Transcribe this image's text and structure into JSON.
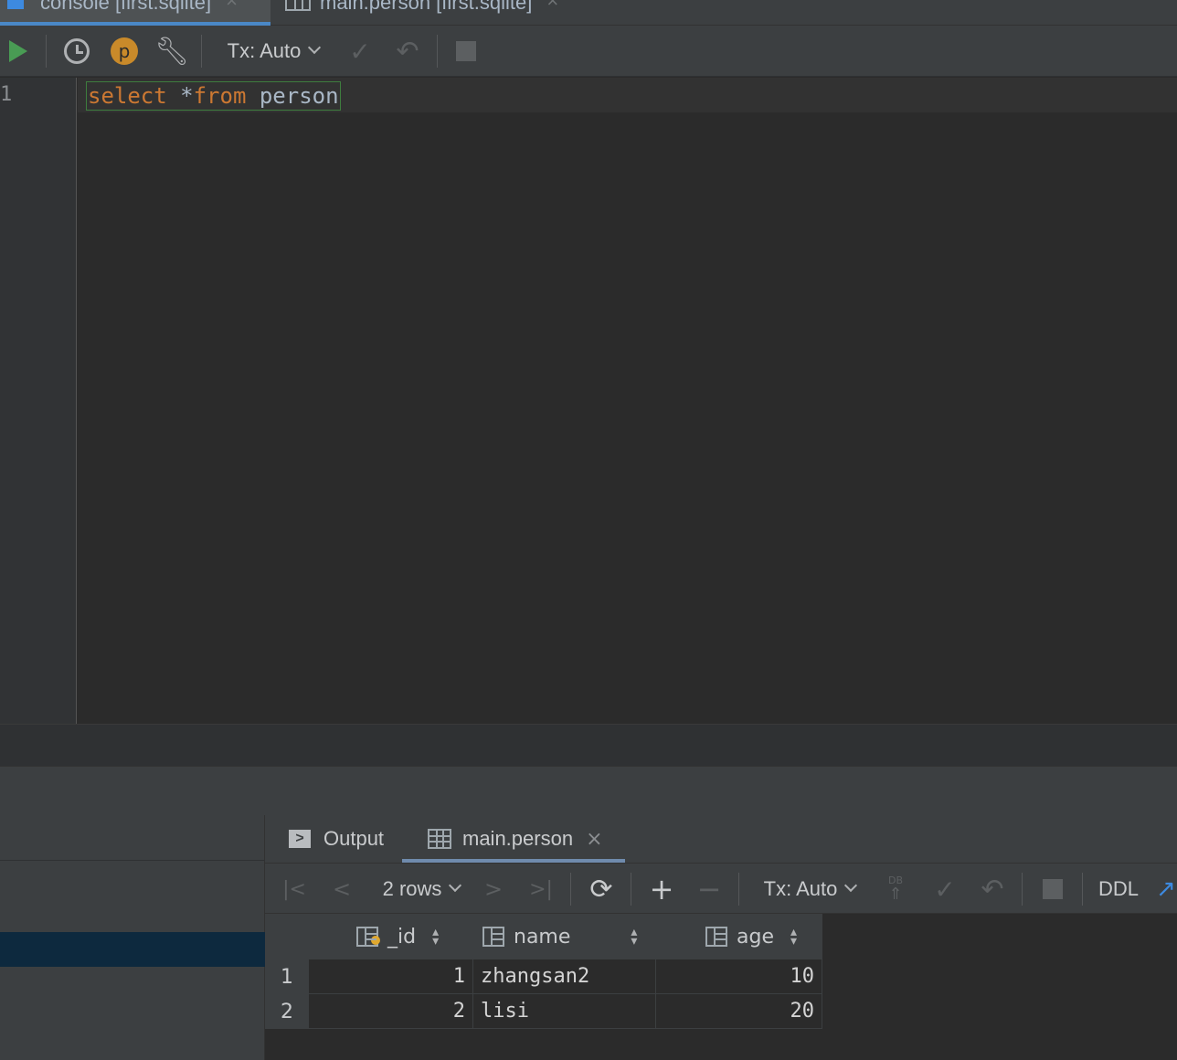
{
  "editor_tabs": [
    {
      "label": "console [first.sqlite]",
      "close": "×",
      "icon": "console-icon",
      "active": true
    },
    {
      "label": "main.person [first.sqlite]",
      "close": "×",
      "icon": "table-icon",
      "active": false
    }
  ],
  "toolbar": {
    "run_icon": "play-icon",
    "history_icon": "clock-icon",
    "profile_badge": "p",
    "settings_icon": "wrench-icon",
    "tx_mode": "Tx: Auto",
    "commit_icon": "check-icon",
    "rollback_icon": "undo-icon",
    "stop_icon": "stop-icon"
  },
  "editor": {
    "line_number": "1",
    "code": {
      "kw1": "select ",
      "op": "*",
      "kw2": "from",
      "space": " ",
      "table": "person"
    }
  },
  "results": {
    "tabs": [
      {
        "label": "Output",
        "icon": "output-icon"
      },
      {
        "label": "main.person",
        "icon": "table-icon",
        "close": "×"
      }
    ],
    "toolbar": {
      "first_icon": "|<",
      "prev_icon": "<",
      "rows_label": "2 rows",
      "next_icon": ">",
      "last_icon": ">|",
      "refresh_icon": "⟳",
      "add_icon": "+",
      "remove_icon": "−",
      "tx_mode": "Tx: Auto",
      "db_label": "DB",
      "ddl_label": "DDL"
    },
    "columns": [
      {
        "name": "_id",
        "icon": "primary-key-column-icon"
      },
      {
        "name": "name",
        "icon": "column-icon"
      },
      {
        "name": "age",
        "icon": "column-icon"
      }
    ],
    "rows": [
      {
        "num": "1",
        "_id": "1",
        "name": "zhangsan2",
        "age": "10"
      },
      {
        "num": "2",
        "_id": "2",
        "name": "lisi",
        "age": "20"
      }
    ]
  },
  "colors": {
    "accent": "#4a88c7",
    "keyword": "#cc7832",
    "run": "#499c54",
    "selection": "#0d293e"
  }
}
